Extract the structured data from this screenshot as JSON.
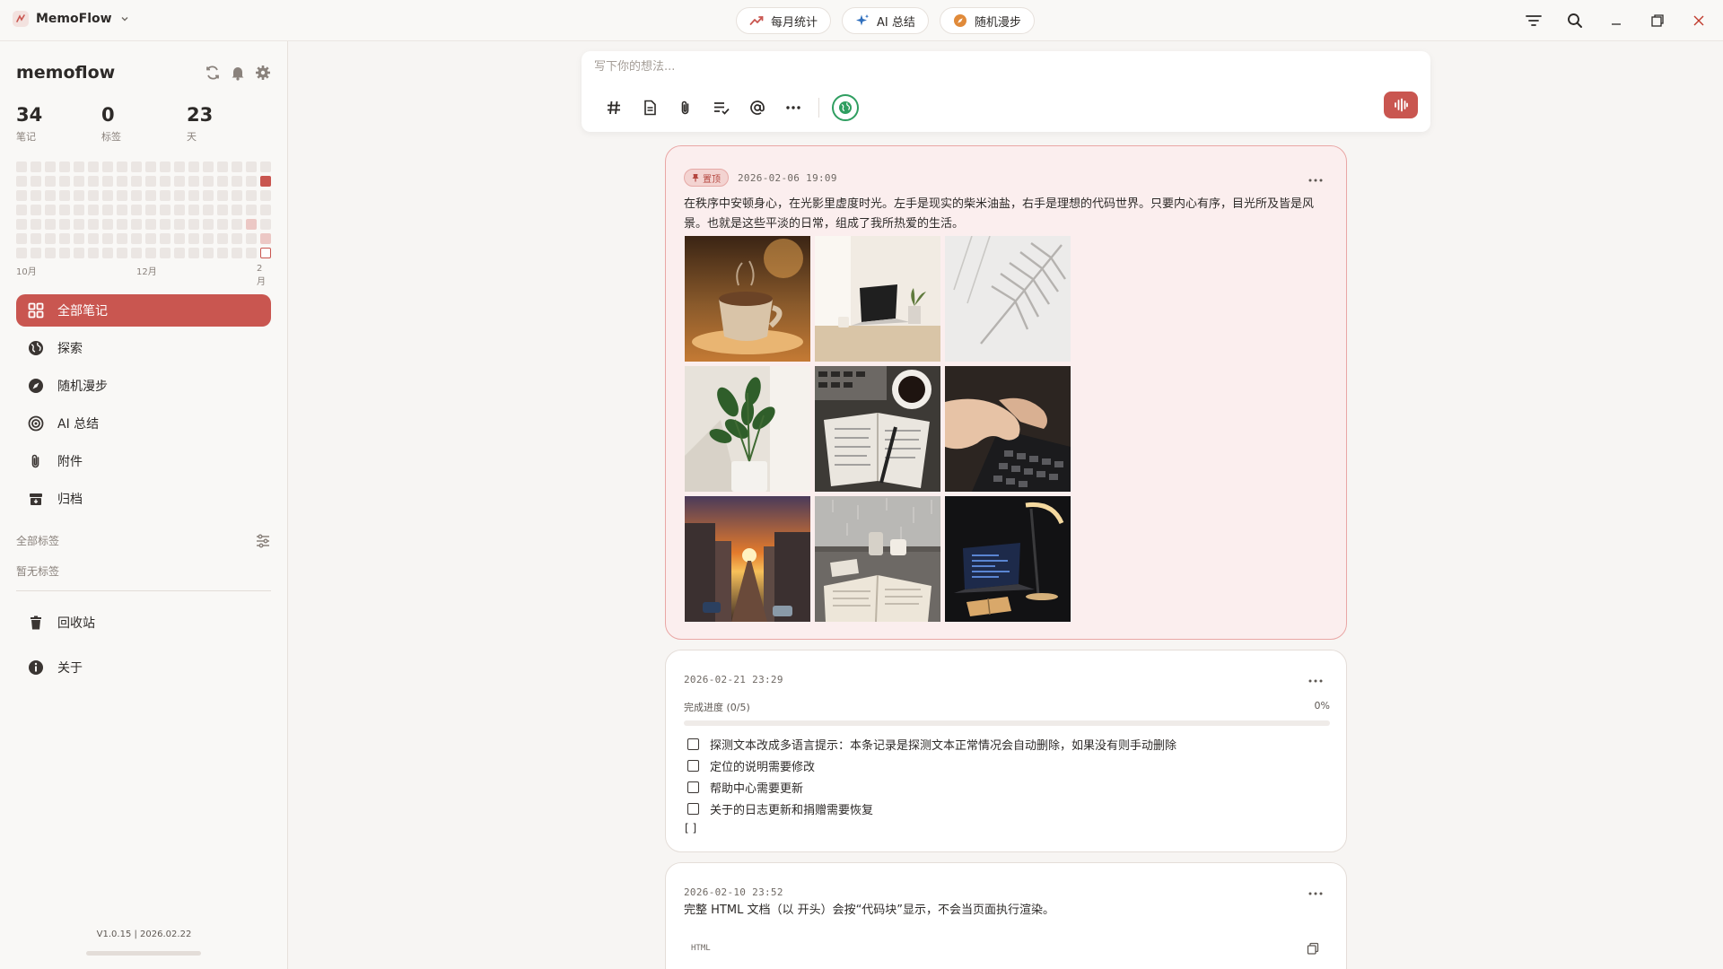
{
  "titlebar": {
    "app_name": "MemoFlow",
    "pills": [
      {
        "label": "每月统计",
        "icon": "trending-icon"
      },
      {
        "label": "AI 总结",
        "icon": "sparkle-icon"
      },
      {
        "label": "随机漫步",
        "icon": "compass-icon"
      }
    ]
  },
  "sidebar": {
    "title": "memoflow",
    "stats": [
      {
        "value": "34",
        "label": "笔记"
      },
      {
        "value": "0",
        "label": "标签"
      },
      {
        "value": "23",
        "label": "天"
      }
    ],
    "heatmap_months": [
      "10月",
      "12月",
      "2月"
    ],
    "nav": [
      {
        "label": "全部笔记",
        "icon": "grid-icon",
        "active": true
      },
      {
        "label": "探索",
        "icon": "globe-icon"
      },
      {
        "label": "随机漫步",
        "icon": "compass-icon"
      },
      {
        "label": "AI 总结",
        "icon": "ai-summary-icon"
      },
      {
        "label": "附件",
        "icon": "paperclip-icon"
      },
      {
        "label": "归档",
        "icon": "archive-icon"
      }
    ],
    "tags_header": "全部标签",
    "tags_empty": "暂无标签",
    "bottom_nav": [
      {
        "label": "回收站",
        "icon": "trash-icon"
      },
      {
        "label": "关于",
        "icon": "info-icon"
      }
    ],
    "version": "V1.0.15 | 2026.02.22"
  },
  "composer": {
    "placeholder": "写下你的想法..."
  },
  "memos": [
    {
      "pinned_label": "置顶",
      "timestamp": "2026-02-06 19:09",
      "text": "在秩序中安顿身心，在光影里虚度时光。左手是现实的柴米油盐，右手是理想的代码世界。只要内心有序，目光所及皆是风景。也就是这些平淡的日常，组成了我所热爱的生活。",
      "images": [
        "coffee-cup-photo",
        "laptop-desk-photo",
        "palm-shadow-photo",
        "potted-plant-photo",
        "notebook-coffee-photo",
        "typing-hands-photo",
        "sunset-street-photo",
        "rainy-window-reading-photo",
        "desk-lamp-laptop-photo"
      ]
    },
    {
      "timestamp": "2026-02-21 23:29",
      "progress_label": "完成进度 (0/5)",
      "progress_percent": "0%",
      "progress_value": 0,
      "todos": [
        "探测文本改成多语言提示：本条记录是探测文本正常情况会自动删除，如果没有则手动删除",
        "定位的说明需要修改",
        "帮助中心需要更新",
        "关于的日志更新和捐赠需要恢复"
      ],
      "trailing": "[ ]"
    },
    {
      "timestamp": "2026-02-10 23:52",
      "text": "完整 HTML 文档（以 开头）会按“代码块”显示，不会当页面执行渲染。",
      "code_lang": "HTML"
    }
  ],
  "colors": {
    "accent": "#c95650",
    "pinned_bg": "#fbeeee",
    "visibility_green": "#2f9e60"
  }
}
